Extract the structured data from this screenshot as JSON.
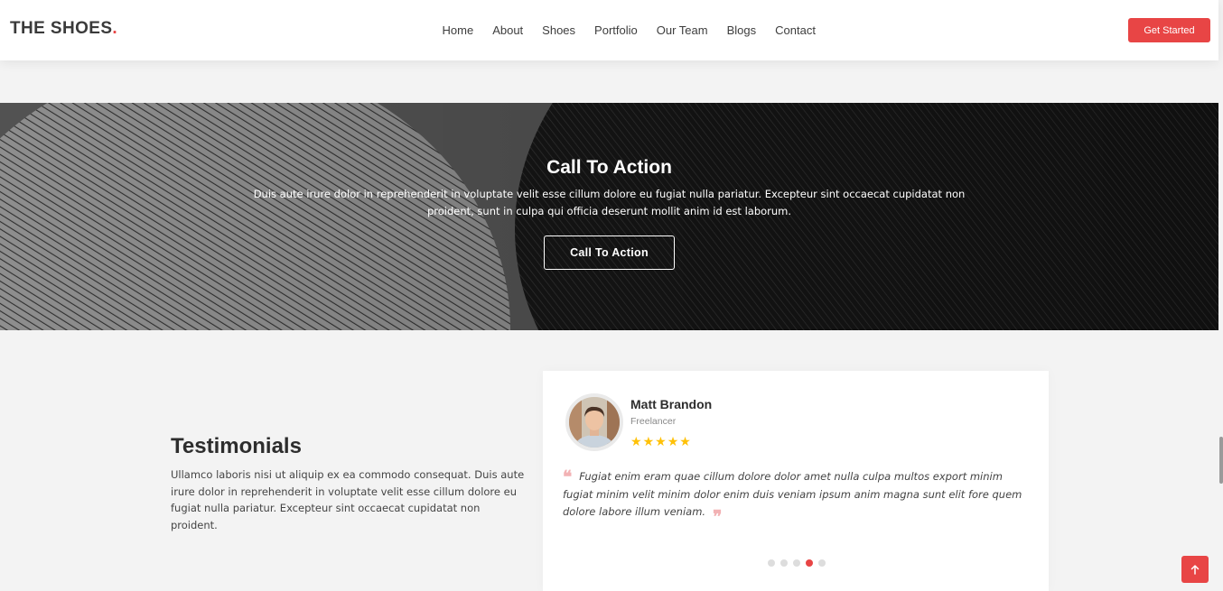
{
  "header": {
    "logo_text": "THE SHOES",
    "logo_dot": ".",
    "nav": [
      {
        "label": "Home"
      },
      {
        "label": "About"
      },
      {
        "label": "Shoes"
      },
      {
        "label": "Portfolio"
      },
      {
        "label": "Our Team"
      },
      {
        "label": "Blogs"
      },
      {
        "label": "Contact"
      }
    ],
    "cta_label": "Get Started"
  },
  "cta": {
    "title": "Call To Action",
    "text": "Duis aute irure dolor in reprehenderit in voluptate velit esse cillum dolore eu fugiat nulla pariatur. Excepteur sint occaecat cupidatat non proident, sunt in culpa qui officia deserunt mollit anim id est laborum.",
    "button_label": "Call To Action"
  },
  "testimonials": {
    "title": "Testimonials",
    "description": "Ullamco laboris nisi ut aliquip ex ea commodo consequat. Duis aute irure dolor in reprehenderit in voluptate velit esse cillum dolore eu fugiat nulla pariatur. Excepteur sint occaecat cupidatat non proident.",
    "card": {
      "name": "Matt Brandon",
      "role": "Freelancer",
      "rating": 5,
      "quote": "Fugiat enim eram quae cillum dolore dolor amet nulla culpa multos export minim fugiat minim velit minim dolor enim duis veniam ipsum anim magna sunt elit fore quem dolore labore illum veniam."
    },
    "pagination": {
      "count": 5,
      "active_index": 3
    }
  },
  "colors": {
    "accent": "#e84545",
    "star": "#ffc107",
    "background": "#f3f3f3"
  },
  "icons": {
    "quote_open": "quote-open-icon",
    "quote_close": "quote-close-icon",
    "back_to_top": "arrow-up-icon"
  }
}
